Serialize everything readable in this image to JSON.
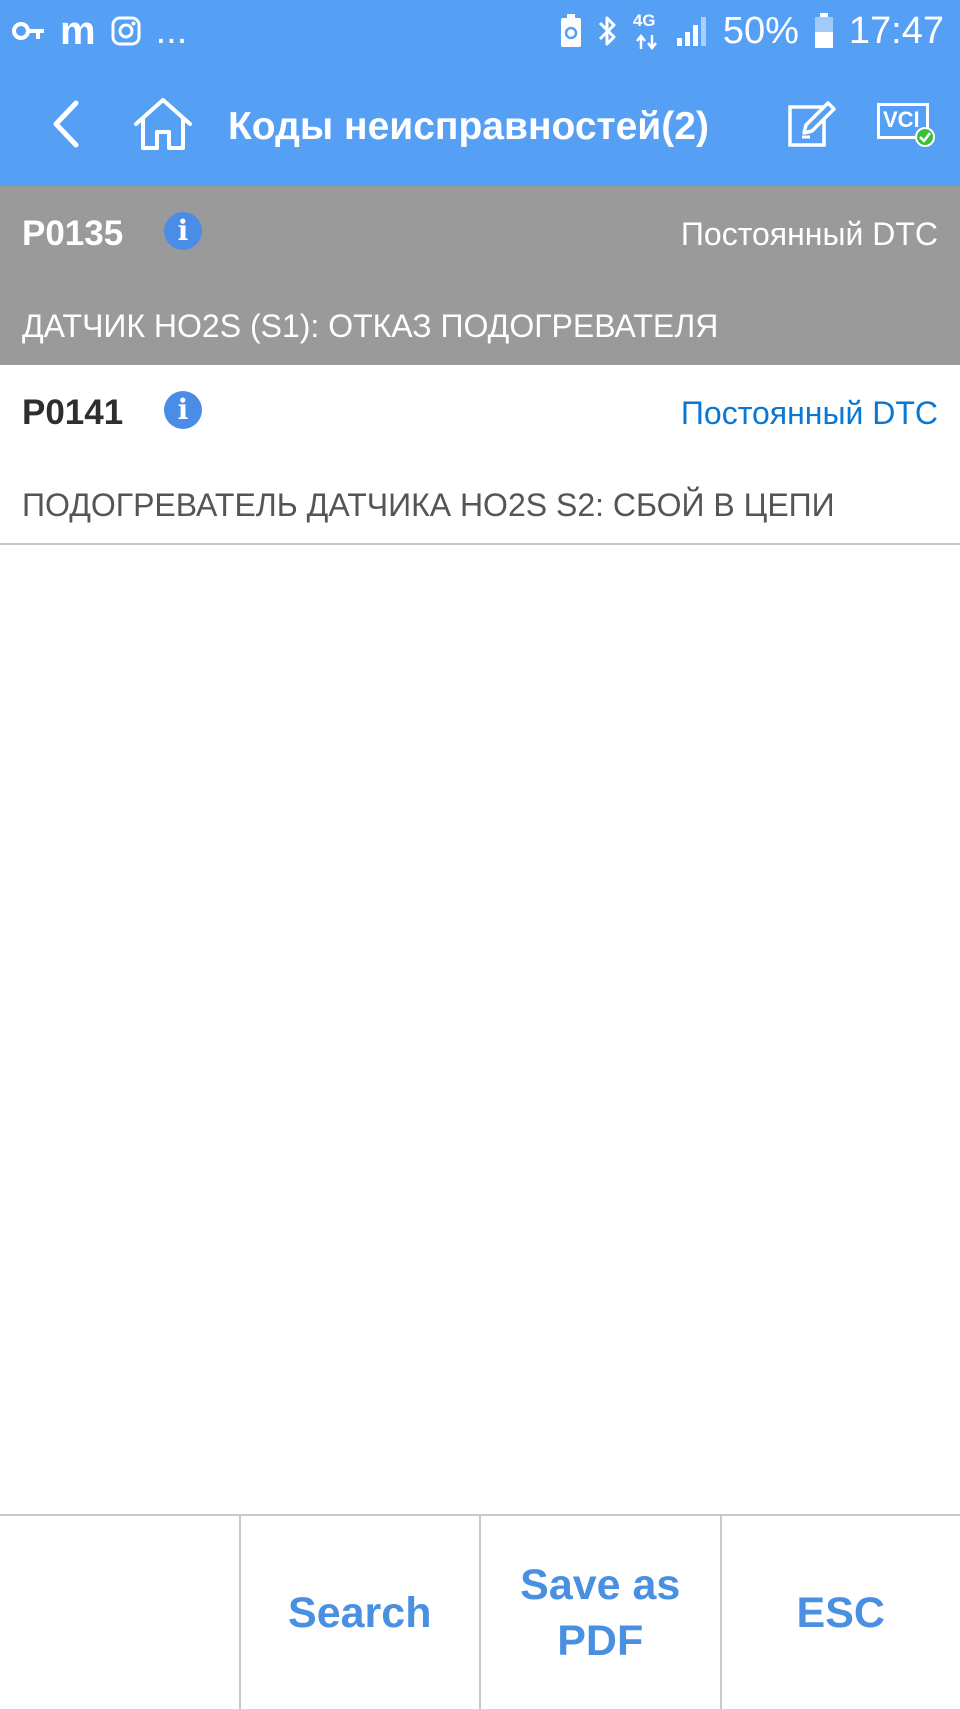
{
  "status_bar": {
    "left_icons": [
      "key-icon",
      "m-icon",
      "instagram-icon"
    ],
    "more": "...",
    "network": "4G",
    "battery": "50%",
    "time": "17:47"
  },
  "header": {
    "title": "Коды неисправностей(2)",
    "vci_label": "VCI"
  },
  "dtc_list": [
    {
      "code": "P0135",
      "status": "Постоянный DTC",
      "description": "ДАТЧИК HO2S (S1): ОТКАЗ ПОДОГРЕВАТЕЛЯ",
      "selected": true
    },
    {
      "code": "P0141",
      "status": "Постоянный DTC",
      "description": "ПОДОГРЕВАТЕЛЬ ДАТЧИКА HO2S S2: СБОЙ В ЦЕПИ",
      "selected": false
    }
  ],
  "bottom_bar": {
    "blank": "",
    "search": "Search",
    "save_pdf": "Save as PDF",
    "esc": "ESC"
  },
  "colors": {
    "primary": "#559ff5",
    "selected_row": "#9a9a9a",
    "status_blue": "#0a77d5",
    "button_text": "#4a90e2",
    "vci_ok": "#3bbf3b"
  }
}
